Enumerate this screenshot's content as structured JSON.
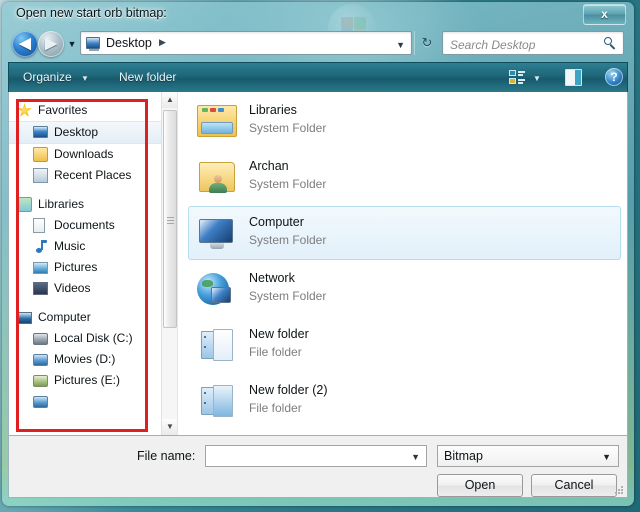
{
  "window": {
    "title": "Open new start orb bitmap:",
    "close_label": "x"
  },
  "navbar": {
    "back_glyph": "◀",
    "forward_glyph": "▶",
    "history_caret": "▼",
    "breadcrumb": "Desktop",
    "breadcrumb_sep": "▶",
    "address_caret": "▼",
    "refresh_glyph": "↻",
    "search_placeholder": "Search Desktop",
    "search_value": ""
  },
  "toolbar": {
    "organize_label": "Organize",
    "organize_caret": "▼",
    "new_folder_label": "New folder",
    "view_caret": "▼",
    "help_label": "?"
  },
  "sidebar": {
    "groups": [
      {
        "header": {
          "label": "Favorites",
          "icon": "star-icon"
        },
        "items": [
          {
            "label": "Desktop",
            "icon": "monitor-icon",
            "selected": true
          },
          {
            "label": "Downloads",
            "icon": "downloads-folder-icon",
            "selected": false
          },
          {
            "label": "Recent Places",
            "icon": "recent-places-icon",
            "selected": false
          }
        ]
      },
      {
        "header": {
          "label": "Libraries",
          "icon": "libraries-icon"
        },
        "items": [
          {
            "label": "Documents",
            "icon": "document-icon",
            "selected": false
          },
          {
            "label": "Music",
            "icon": "music-note-icon",
            "selected": false
          },
          {
            "label": "Pictures",
            "icon": "picture-icon",
            "selected": false
          },
          {
            "label": "Videos",
            "icon": "video-icon",
            "selected": false
          }
        ]
      },
      {
        "header": {
          "label": "Computer",
          "icon": "computer-icon"
        },
        "items": [
          {
            "label": "Local Disk (C:)",
            "icon": "hard-drive-icon",
            "selected": false
          },
          {
            "label": "Movies (D:)",
            "icon": "hard-drive-icon",
            "selected": false
          },
          {
            "label": "Pictures (E:)",
            "icon": "hard-drive-icon",
            "selected": false
          }
        ]
      }
    ],
    "scroll_up_glyph": "▲",
    "scroll_down_glyph": "▼"
  },
  "files": {
    "items": [
      {
        "name": "Libraries",
        "type": "System Folder",
        "icon": "libraries-folder-icon",
        "selected": false
      },
      {
        "name": "Archan",
        "type": "System Folder",
        "icon": "user-folder-icon",
        "selected": false
      },
      {
        "name": "Computer",
        "type": "System Folder",
        "icon": "computer-icon",
        "selected": true
      },
      {
        "name": "Network",
        "type": "System Folder",
        "icon": "network-icon",
        "selected": false
      },
      {
        "name": "New folder",
        "type": "File folder",
        "icon": "folder-icon",
        "selected": false
      },
      {
        "name": "New folder (2)",
        "type": "File folder",
        "icon": "folder-icon",
        "selected": false
      }
    ]
  },
  "footer": {
    "file_name_label": "File name:",
    "file_name_value": "",
    "file_type_value": "Bitmap",
    "combo_caret": "▼",
    "open_label": "Open",
    "cancel_label": "Cancel"
  },
  "colors": {
    "accent": "#2d7f8c",
    "selection": "#e2f0fa",
    "annotation": "#e02020"
  }
}
